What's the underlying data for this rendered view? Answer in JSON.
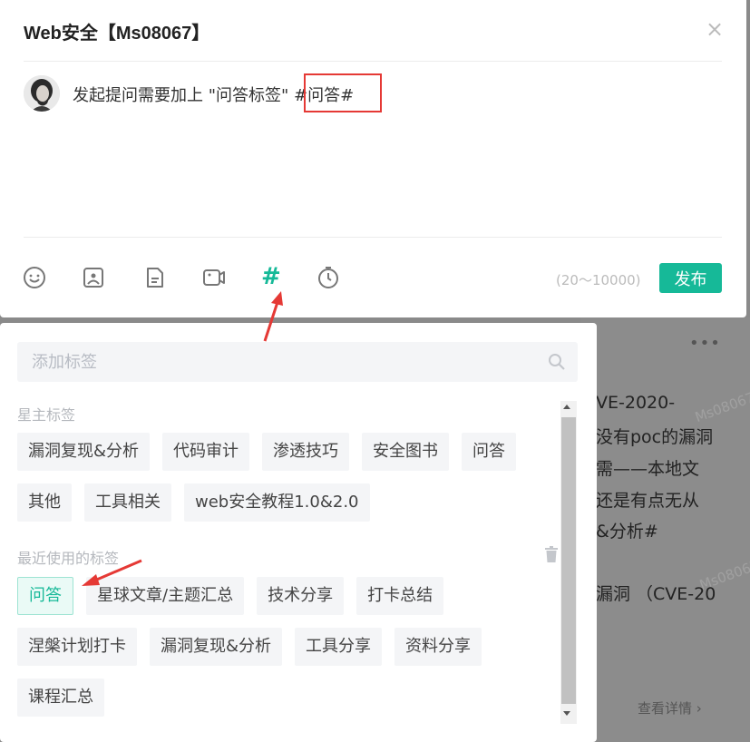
{
  "dialog": {
    "title": "Web安全【Ms08067】",
    "close_label": "×",
    "editor_text": "发起提问需要加上 \"问答标签\"  #问答#",
    "counter": "(20～10000)",
    "publish_label": "发布",
    "toolbar_icons": [
      "emoji-icon",
      "image-icon",
      "file-icon",
      "video-icon",
      "hashtag-icon",
      "timer-icon"
    ],
    "hashtag_glyph": "#"
  },
  "tag_popup": {
    "search_placeholder": "添加标签",
    "owner_label": "星主标签",
    "owner_tags": [
      "漏洞复现&分析",
      "代码审计",
      "渗透技巧",
      "安全图书",
      "问答",
      "其他",
      "工具相关",
      "web安全教程1.0&2.0"
    ],
    "recent_label": "最近使用的标签",
    "recent_tags": [
      "问答",
      "星球文章/主题汇总",
      "技术分享",
      "打卡总结",
      "涅槃计划打卡",
      "漏洞复现&分析",
      "工具分享",
      "资料分享",
      "课程汇总"
    ],
    "active_tag": "问答"
  },
  "background": {
    "more_glyph": "•••",
    "lines": [
      "VE-2020-",
      "没有poc的漏洞",
      "需——本地文",
      "还是有点无从",
      "&分析#",
      "漏洞 （CVE-20"
    ],
    "detail_link": "查看详情",
    "watermark": "Ms08067"
  },
  "colors": {
    "accent": "#16b998",
    "highlight": "#e53935"
  }
}
